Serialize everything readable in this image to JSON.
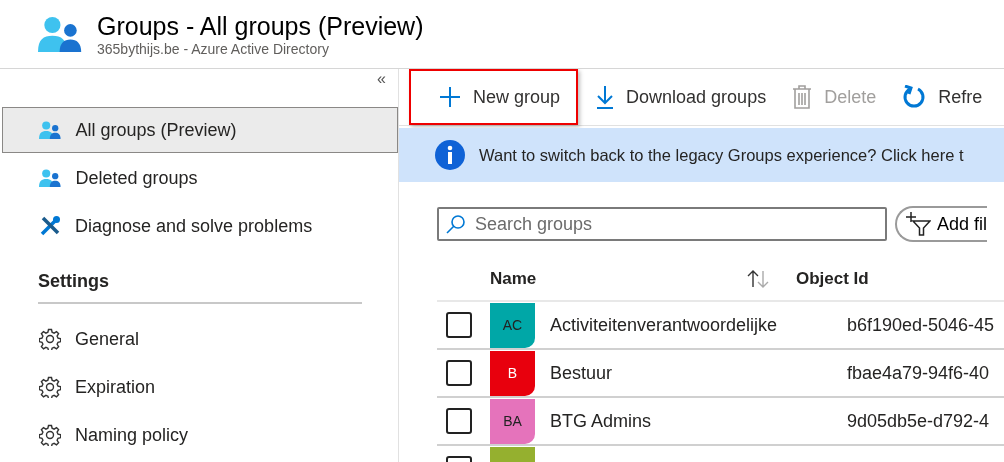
{
  "header": {
    "title": "Groups - All groups (Preview)",
    "subtitle": "365bythijs.be - Azure Active Directory"
  },
  "sidebar": {
    "collapse": "«",
    "items": [
      {
        "label": "All groups (Preview)",
        "kind": "group",
        "selected": true
      },
      {
        "label": "Deleted groups",
        "kind": "group",
        "selected": false
      },
      {
        "label": "Diagnose and solve problems",
        "kind": "tools",
        "selected": false
      }
    ],
    "settings": {
      "heading": "Settings",
      "items": [
        {
          "label": "General",
          "selected": false
        },
        {
          "label": "Expiration",
          "selected": false
        },
        {
          "label": "Naming policy",
          "selected": false
        }
      ]
    }
  },
  "toolbar": [
    {
      "label": "New group",
      "kind": "add",
      "highlighted": true,
      "disabled": false
    },
    {
      "label": "Download groups",
      "kind": "download",
      "highlighted": false,
      "disabled": false
    },
    {
      "label": "Delete",
      "kind": "delete",
      "highlighted": false,
      "disabled": true
    },
    {
      "label": "Refre",
      "kind": "refresh",
      "highlighted": false,
      "disabled": false
    }
  ],
  "banner": "Want to switch back to the legacy Groups experience? Click here t",
  "search": {
    "placeholder": "Search groups"
  },
  "add_filter": "Add fil",
  "table": {
    "columns": [
      {
        "label": "Name",
        "sortable": true
      },
      {
        "label": "Object Id"
      }
    ],
    "rows": [
      {
        "initials": "AC",
        "color": "#00a7a7",
        "name": "Activiteitenverantwoordelijke",
        "object_id": "b6f190ed-5046-45",
        "checked": false
      },
      {
        "initials": "B",
        "color": "#e8000d",
        "name": "Bestuur",
        "object_id": "fbae4a79-94f6-40",
        "checked": false
      },
      {
        "initials": "BA",
        "color": "#e573bb",
        "name": "BTG Admins",
        "object_id": "9d05db5e-d792-4",
        "checked": false
      },
      {
        "color": "#95b02f",
        "checked": false
      }
    ]
  }
}
